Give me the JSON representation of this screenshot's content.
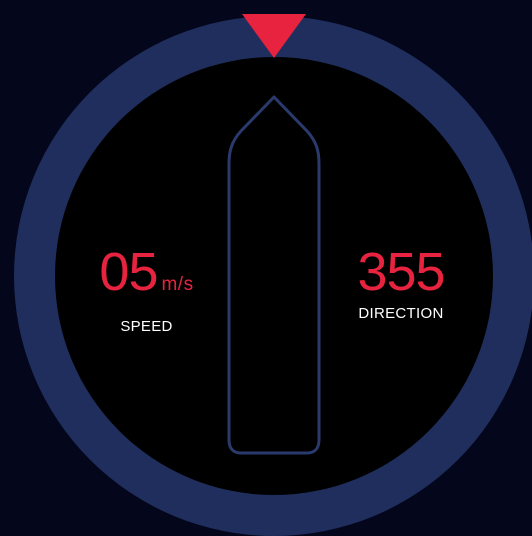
{
  "speed": {
    "value": "05",
    "unit": "m/s",
    "label": "SPEED"
  },
  "direction": {
    "value": "355",
    "label": "DIRECTION"
  },
  "colors": {
    "background": "#04061c",
    "bezel": "#1f2e5d",
    "dial_face": "#000000",
    "hull_outline": "#2a3a6c",
    "accent": "#e8233f",
    "label_text": "#ffffff"
  },
  "icons": {
    "heading_marker": "triangle-down-icon",
    "vessel": "boat-hull-icon"
  }
}
